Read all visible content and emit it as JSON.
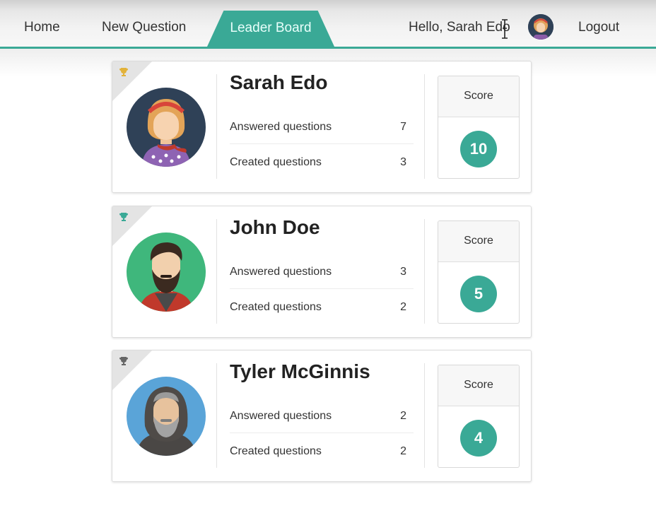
{
  "nav": {
    "home": "Home",
    "new_question": "New Question",
    "leader_board": "Leader Board",
    "greeting": "Hello, Sarah Edo",
    "logout": "Logout",
    "accent_color": "#3aa996"
  },
  "leaderboard": [
    {
      "rank": 1,
      "name": "Sarah Edo",
      "answered_label": "Answered questions",
      "answered": "7",
      "created_label": "Created questions",
      "created": "3",
      "score_label": "Score",
      "score": "10",
      "trophy_color": "#e2b23a",
      "avatar": "woman-with-headband-avatar"
    },
    {
      "rank": 2,
      "name": "John Doe",
      "answered_label": "Answered questions",
      "answered": "3",
      "created_label": "Created questions",
      "created": "2",
      "score_label": "Score",
      "score": "5",
      "trophy_color": "#3aa996",
      "avatar": "bearded-man-avatar"
    },
    {
      "rank": 3,
      "name": "Tyler McGinnis",
      "answered_label": "Answered questions",
      "answered": "2",
      "created_label": "Created questions",
      "created": "2",
      "score_label": "Score",
      "score": "4",
      "trophy_color": "#666666",
      "avatar": "hooded-man-avatar"
    }
  ]
}
